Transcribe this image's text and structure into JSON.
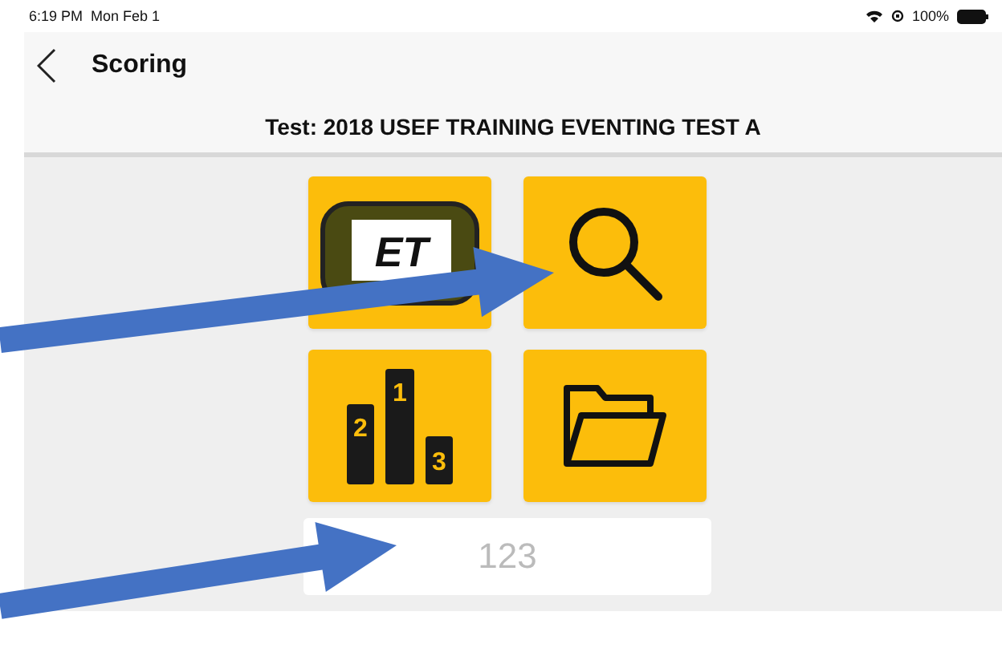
{
  "status_bar": {
    "time": "6:19 PM",
    "date": "Mon Feb 1",
    "battery": "100%"
  },
  "nav": {
    "title": "Scoring"
  },
  "subtitle": "Test: 2018 USEF TRAINING EVENTING TEST A",
  "tiles": [
    {
      "kind": "device",
      "logo": "ET"
    },
    {
      "kind": "search"
    },
    {
      "kind": "podium",
      "places": [
        "1",
        "2",
        "3"
      ]
    },
    {
      "kind": "folder"
    }
  ],
  "number_field": {
    "placeholder": "123"
  },
  "annotations": [
    {
      "kind": "arrow"
    },
    {
      "kind": "arrow"
    }
  ]
}
